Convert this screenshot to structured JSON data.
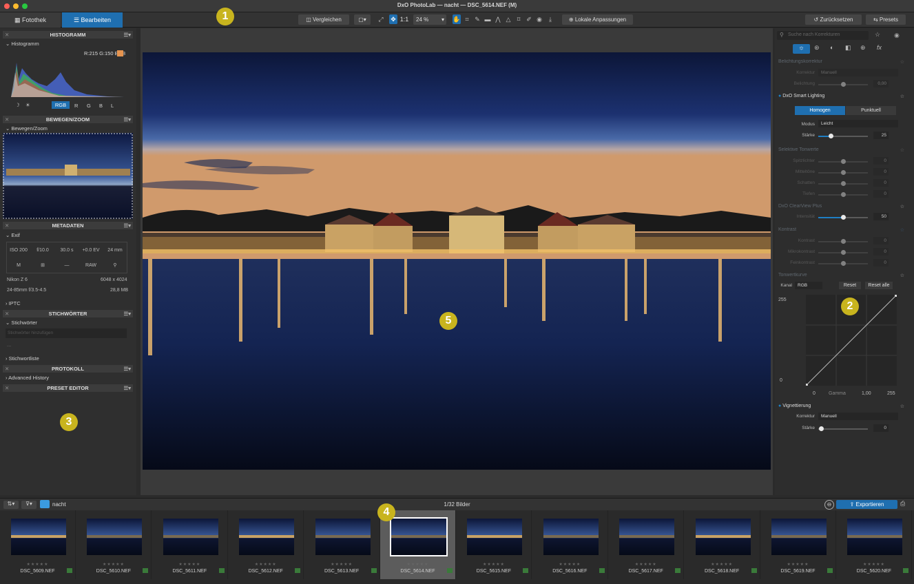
{
  "window": {
    "title": "DxO PhotoLab — nacht — DSC_5614.NEF (M)"
  },
  "tabs": {
    "library": "Fotothek",
    "edit": "Bearbeiten"
  },
  "toolbar": {
    "compare": "Vergleichen",
    "zoom_1to1": "1:1",
    "zoom": "24 %",
    "local": "Lokale Anpassungen",
    "reset": "Zurücksetzen",
    "presets": "Presets"
  },
  "callouts": [
    "1",
    "2",
    "3",
    "4",
    "5"
  ],
  "left": {
    "histogram_panel": "HISTOGRAMM",
    "histogram_sub": "Histogramm",
    "rgb_readout": "R:215 G:150 B:88",
    "channels": [
      "RGB",
      "R",
      "G",
      "B",
      "L"
    ],
    "move_zoom_panel": "BEWEGEN/ZOOM",
    "move_zoom_sub": "Bewegen/Zoom",
    "metadata_panel": "METADATEN",
    "exif": "Exif",
    "exif_row1": [
      "ISO 200",
      "f/10.0",
      "30.0 s",
      "+0.0 EV",
      "24 mm"
    ],
    "exif_row2": [
      "M",
      "",
      "—",
      "RAW",
      ""
    ],
    "camera": "Nikon Z 6",
    "dimensions": "6048 x 4024",
    "lens": "24-85mm f/3.5-4.5",
    "filesize": "28,8 MB",
    "iptc": "IPTC",
    "keywords_panel": "STICHWÖRTER",
    "keywords_sub": "Stichwörter",
    "keywords_placeholder": "Stichwörter hinzufügen",
    "keywords_dots": "...",
    "keyword_list": "Stichwortliste",
    "history_panel": "PROTOKOLL",
    "advanced_history": "Advanced History",
    "preset_editor": "PRESET EDITOR"
  },
  "right": {
    "search_placeholder": "Suche nach Korrekturen",
    "exposure": {
      "title": "Belichtungskorrektur",
      "correction_label": "Korrektur",
      "correction_value": "Manuell",
      "exposure_label": "Belichtung",
      "exposure_value": "0,00"
    },
    "smart_lighting": {
      "title": "DxO Smart Lighting",
      "seg1": "Homogen",
      "seg2": "Punktuell",
      "mode_label": "Modus",
      "mode_value": "Leicht",
      "strength_label": "Stärke",
      "strength_value": "25",
      "strength": 25
    },
    "selective_tone": {
      "title": "Selektive Tonwerte",
      "rows": [
        {
          "label": "Spitzlichter",
          "value": "0"
        },
        {
          "label": "Mitteltöne",
          "value": "0"
        },
        {
          "label": "Schatten",
          "value": "0"
        },
        {
          "label": "Tiefen",
          "value": "0"
        }
      ]
    },
    "clearview": {
      "title": "DxO ClearView Plus",
      "label": "Intensität",
      "value": "50",
      "level": 50
    },
    "contrast": {
      "title": "Kontrast",
      "rows": [
        {
          "label": "Kontrast",
          "value": "0"
        },
        {
          "label": "Mikrokontrast",
          "value": "0"
        },
        {
          "label": "Feinkontrast",
          "value": "0"
        }
      ]
    },
    "tone_curve": {
      "title": "Tonwertkurve",
      "channel_label": "Kanal",
      "channel": "RGB",
      "reset": "Reset",
      "reset_all": "Reset alle",
      "in_max": "255",
      "in_min": "0",
      "out_min": "0",
      "gamma_label": "Gamma",
      "gamma": "1,00",
      "out_max": "255"
    },
    "vignetting": {
      "title": "Vignettierung",
      "correction_label": "Korrektur",
      "correction_value": "Manuell",
      "strength_label": "Stärke",
      "strength_value": "0"
    }
  },
  "filmstrip": {
    "folder": "nacht",
    "count": "1/32 Bilder",
    "export": "Exportieren",
    "files": [
      "DSC_5609.NEF",
      "DSC_5610.NEF",
      "DSC_5611.NEF",
      "DSC_5612.NEF",
      "DSC_5613.NEF",
      "DSC_5614.NEF",
      "DSC_5615.NEF",
      "DSC_5616.NEF",
      "DSC_5617.NEF",
      "DSC_5618.NEF",
      "DSC_5619.NEF",
      "DSC_5620.NEF"
    ],
    "selected_index": 5
  },
  "colors": {
    "accent": "#1f7fc4",
    "badge": "#c8b41e",
    "sky_top": "#0f1a3e",
    "sky_bottom": "#7890b8",
    "water": "#0c1530"
  }
}
